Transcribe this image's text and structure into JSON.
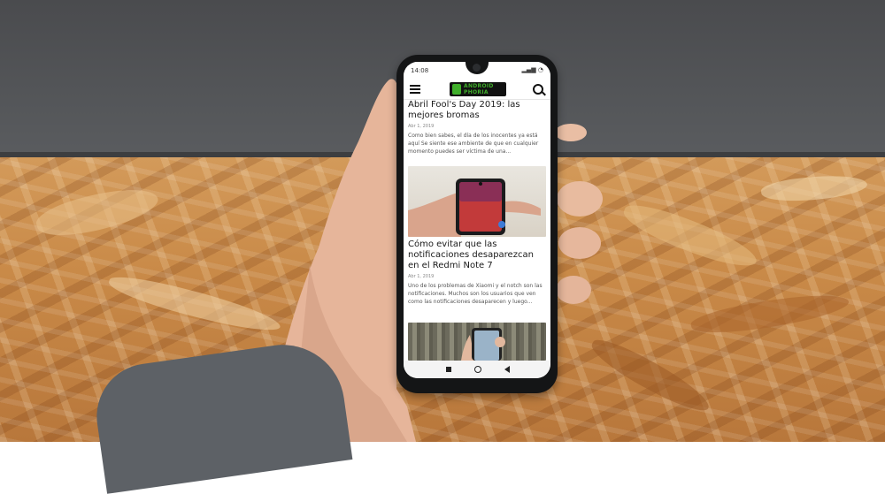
{
  "scene": {
    "wall_color": "#4f5154",
    "table_color": "#c98a48"
  },
  "phone": {
    "status": {
      "time": "14:08"
    },
    "app": {
      "logo_line1": "ANDROID",
      "logo_line2": "PHORIA",
      "logo_accent": "#3fae2a",
      "menu_icon": "menu-icon",
      "search_icon": "search-icon"
    },
    "articles": [
      {
        "title": "Abril Fool's Day 2019: las mejores bromas",
        "date": "Abr 1, 2019",
        "excerpt": "Como bien sabes, el día de los inocentes ya está aquí Se siente ese ambiente de que en cualquier momento puedes ser víctima de una..."
      },
      {
        "title": "Cómo evitar que las notificaciones desaparezcan en el Redmi Note 7",
        "date": "Abr 1, 2019",
        "excerpt": "Uno de los problemas de Xiaomi y el notch son las notificaciones. Muchos son los usuarios que ven como las notificaciones desaparecen y luego..."
      }
    ],
    "navbar": {
      "recents_icon": "square-icon",
      "home_icon": "circle-icon",
      "back_icon": "back-triangle-icon"
    }
  }
}
